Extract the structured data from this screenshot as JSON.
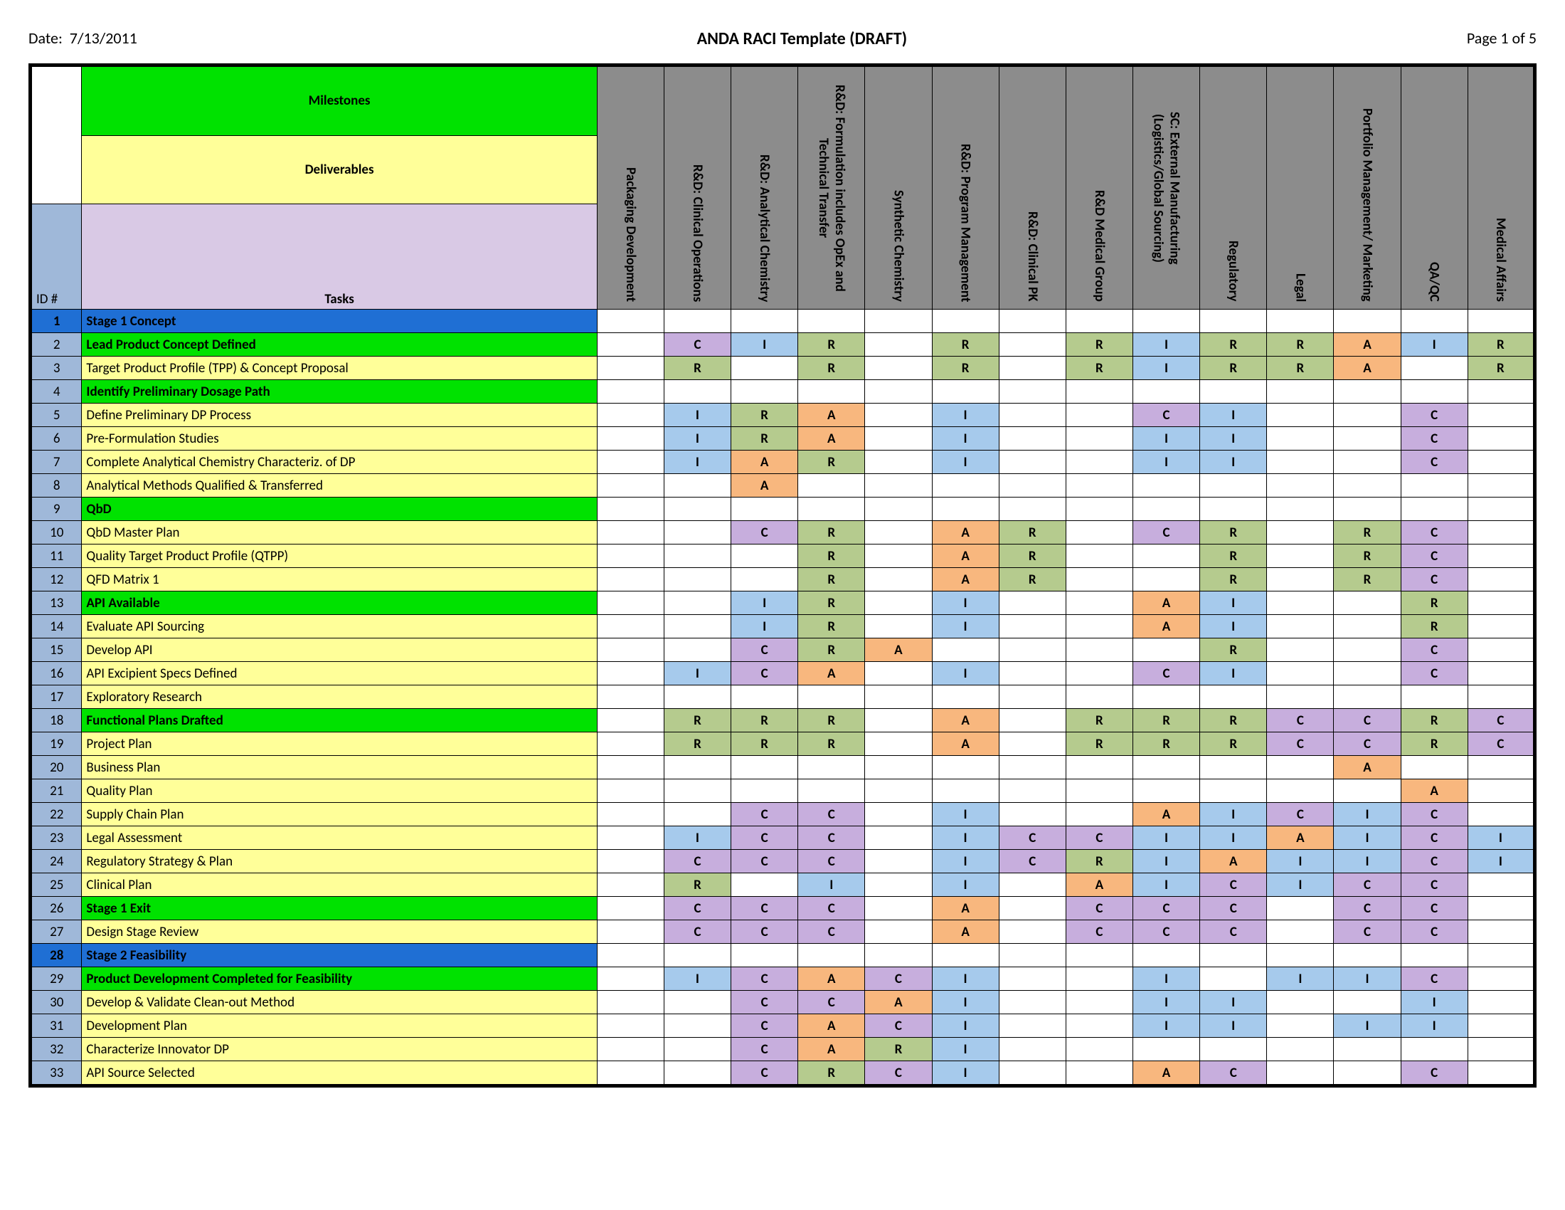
{
  "header": {
    "date_label": "Date:",
    "date": "7/13/2011",
    "title": "ANDA RACI Template (DRAFT)",
    "page": "Page 1 of 5"
  },
  "legend": {
    "milestones": "Milestones",
    "deliverables": "Deliverables",
    "tasks": "Tasks",
    "id_label": "ID #"
  },
  "roles": [
    "Packaging Development",
    "R&D: Clinical Operations",
    "R&D: Analytical Chemistry",
    "R&D: Formulation includes OpEx and Technical Transfer",
    "Synthetic Chemistry",
    "R&D: Program Management",
    "R&D: Clinical PK",
    "R&D Medical Group",
    "SC: External Manufacturing (Logistics/Global Sourcing)",
    "Regulatory",
    "Legal",
    "Portfolio Management/ Marketing",
    "QA/QC",
    "Medical Affairs"
  ],
  "rows": [
    {
      "id": "1",
      "type": "stage",
      "task": "Stage 1 Concept",
      "cells": [
        "",
        "",
        "",
        "",
        "",
        "",
        "",
        "",
        "",
        "",
        "",
        "",
        "",
        ""
      ]
    },
    {
      "id": "2",
      "type": "milestone",
      "task": "Lead Product Concept Defined",
      "cells": [
        "",
        "C",
        "I",
        "R",
        "",
        "R",
        "",
        "R",
        "I",
        "R",
        "R",
        "A",
        "I",
        "R"
      ]
    },
    {
      "id": "3",
      "type": "deliverable",
      "task": "Target Product Profile (TPP) & Concept Proposal",
      "cells": [
        "",
        "R",
        "",
        "R",
        "",
        "R",
        "",
        "R",
        "I",
        "R",
        "R",
        "A",
        "",
        "R"
      ]
    },
    {
      "id": "4",
      "type": "milestone",
      "task": "Identify Preliminary Dosage Path",
      "cells": [
        "",
        "",
        "",
        "",
        "",
        "",
        "",
        "",
        "",
        "",
        "",
        "",
        "",
        ""
      ]
    },
    {
      "id": "5",
      "type": "deliverable",
      "task": "Define Preliminary DP Process",
      "cells": [
        "",
        "I",
        "R",
        "A",
        "",
        "I",
        "",
        "",
        "C",
        "I",
        "",
        "",
        "C",
        ""
      ]
    },
    {
      "id": "6",
      "type": "deliverable",
      "task": "Pre-Formulation Studies",
      "cells": [
        "",
        "I",
        "R",
        "A",
        "",
        "I",
        "",
        "",
        "I",
        "I",
        "",
        "",
        "C",
        ""
      ]
    },
    {
      "id": "7",
      "type": "deliverable",
      "task": "Complete Analytical Chemistry Characteriz. of DP",
      "cells": [
        "",
        "I",
        "A",
        "R",
        "",
        "I",
        "",
        "",
        "I",
        "I",
        "",
        "",
        "C",
        ""
      ]
    },
    {
      "id": "8",
      "type": "deliverable",
      "task": "Analytical Methods Qualified & Transferred",
      "cells": [
        "",
        "",
        "A",
        "",
        "",
        "",
        "",
        "",
        "",
        "",
        "",
        "",
        "",
        ""
      ]
    },
    {
      "id": "9",
      "type": "milestone",
      "task": "QbD",
      "cells": [
        "",
        "",
        "",
        "",
        "",
        "",
        "",
        "",
        "",
        "",
        "",
        "",
        "",
        ""
      ]
    },
    {
      "id": "10",
      "type": "deliverable",
      "task": "QbD Master Plan",
      "cells": [
        "",
        "",
        "C",
        "R",
        "",
        "A",
        "R",
        "",
        "C",
        "R",
        "",
        "R",
        "C",
        ""
      ]
    },
    {
      "id": "11",
      "type": "deliverable",
      "task": "Quality Target Product Profile (QTPP)",
      "cells": [
        "",
        "",
        "",
        "R",
        "",
        "A",
        "R",
        "",
        "",
        "R",
        "",
        "R",
        "C",
        ""
      ]
    },
    {
      "id": "12",
      "type": "deliverable",
      "task": "QFD Matrix 1",
      "cells": [
        "",
        "",
        "",
        "R",
        "",
        "A",
        "R",
        "",
        "",
        "R",
        "",
        "R",
        "C",
        ""
      ]
    },
    {
      "id": "13",
      "type": "milestone",
      "task": "API Available",
      "cells": [
        "",
        "",
        "I",
        "R",
        "",
        "I",
        "",
        "",
        "A",
        "I",
        "",
        "",
        "R",
        ""
      ]
    },
    {
      "id": "14",
      "type": "deliverable",
      "task": "Evaluate API Sourcing",
      "cells": [
        "",
        "",
        "I",
        "R",
        "",
        "I",
        "",
        "",
        "A",
        "I",
        "",
        "",
        "R",
        ""
      ]
    },
    {
      "id": "15",
      "type": "deliverable",
      "task": "Develop API",
      "cells": [
        "",
        "",
        "C",
        "R",
        "A",
        "",
        "",
        "",
        "",
        "R",
        "",
        "",
        "C",
        ""
      ]
    },
    {
      "id": "16",
      "type": "deliverable",
      "task": "API Excipient Specs Defined",
      "cells": [
        "",
        "I",
        "C",
        "A",
        "",
        "I",
        "",
        "",
        "C",
        "I",
        "",
        "",
        "C",
        ""
      ]
    },
    {
      "id": "17",
      "type": "deliverable",
      "task": "Exploratory Research",
      "cells": [
        "",
        "",
        "",
        "",
        "",
        "",
        "",
        "",
        "",
        "",
        "",
        "",
        "",
        ""
      ]
    },
    {
      "id": "18",
      "type": "milestone",
      "task": "Functional Plans Drafted",
      "cells": [
        "",
        "R",
        "R",
        "R",
        "",
        "A",
        "",
        "R",
        "R",
        "R",
        "C",
        "C",
        "R",
        "C"
      ]
    },
    {
      "id": "19",
      "type": "deliverable",
      "task": "Project Plan",
      "cells": [
        "",
        "R",
        "R",
        "R",
        "",
        "A",
        "",
        "R",
        "R",
        "R",
        "C",
        "C",
        "R",
        "C"
      ]
    },
    {
      "id": "20",
      "type": "deliverable",
      "task": "Business Plan",
      "cells": [
        "",
        "",
        "",
        "",
        "",
        "",
        "",
        "",
        "",
        "",
        "",
        "A",
        "",
        ""
      ]
    },
    {
      "id": "21",
      "type": "deliverable",
      "task": "Quality Plan",
      "cells": [
        "",
        "",
        "",
        "",
        "",
        "",
        "",
        "",
        "",
        "",
        "",
        "",
        "A",
        ""
      ]
    },
    {
      "id": "22",
      "type": "deliverable",
      "task": "Supply Chain Plan",
      "cells": [
        "",
        "",
        "C",
        "C",
        "",
        "I",
        "",
        "",
        "A",
        "I",
        "C",
        "I",
        "C",
        ""
      ]
    },
    {
      "id": "23",
      "type": "deliverable",
      "task": "Legal Assessment",
      "cells": [
        "",
        "I",
        "C",
        "C",
        "",
        "I",
        "C",
        "C",
        "I",
        "I",
        "A",
        "I",
        "C",
        "I"
      ]
    },
    {
      "id": "24",
      "type": "deliverable",
      "task": "Regulatory Strategy & Plan",
      "cells": [
        "",
        "C",
        "C",
        "C",
        "",
        "I",
        "C",
        "R",
        "I",
        "A",
        "I",
        "I",
        "C",
        "I"
      ]
    },
    {
      "id": "25",
      "type": "deliverable",
      "task": "Clinical Plan",
      "cells": [
        "",
        "R",
        "",
        "I",
        "",
        "I",
        "",
        "A",
        "I",
        "C",
        "I",
        "C",
        "C",
        ""
      ]
    },
    {
      "id": "26",
      "type": "milestone",
      "task": "Stage 1 Exit",
      "cells": [
        "",
        "C",
        "C",
        "C",
        "",
        "A",
        "",
        "C",
        "C",
        "C",
        "",
        "C",
        "C",
        ""
      ]
    },
    {
      "id": "27",
      "type": "deliverable",
      "task": "Design Stage Review",
      "cells": [
        "",
        "C",
        "C",
        "C",
        "",
        "A",
        "",
        "C",
        "C",
        "C",
        "",
        "C",
        "C",
        ""
      ]
    },
    {
      "id": "28",
      "type": "stage",
      "task": "Stage 2 Feasibility",
      "cells": [
        "",
        "",
        "",
        "",
        "",
        "",
        "",
        "",
        "",
        "",
        "",
        "",
        "",
        ""
      ]
    },
    {
      "id": "29",
      "type": "milestone",
      "task": "Product Development Completed for Feasibility",
      "cells": [
        "",
        "I",
        "C",
        "A",
        "C",
        "I",
        "",
        "",
        "I",
        "",
        "I",
        "I",
        "C",
        ""
      ]
    },
    {
      "id": "30",
      "type": "deliverable",
      "task": "Develop & Validate Clean-out Method",
      "cells": [
        "",
        "",
        "C",
        "C",
        "A",
        "I",
        "",
        "",
        "I",
        "I",
        "",
        "",
        "I",
        ""
      ]
    },
    {
      "id": "31",
      "type": "deliverable",
      "task": "Development Plan",
      "cells": [
        "",
        "",
        "C",
        "A",
        "C",
        "I",
        "",
        "",
        "I",
        "I",
        "",
        "I",
        "I",
        ""
      ]
    },
    {
      "id": "32",
      "type": "deliverable",
      "task": "Characterize Innovator DP",
      "cells": [
        "",
        "",
        "C",
        "A",
        "R",
        "I",
        "",
        "",
        "",
        "",
        "",
        "",
        "",
        ""
      ]
    },
    {
      "id": "33",
      "type": "deliverable",
      "task": "API Source Selected",
      "cells": [
        "",
        "",
        "C",
        "R",
        "C",
        "I",
        "",
        "",
        "A",
        "C",
        "",
        "",
        "C",
        ""
      ]
    }
  ]
}
